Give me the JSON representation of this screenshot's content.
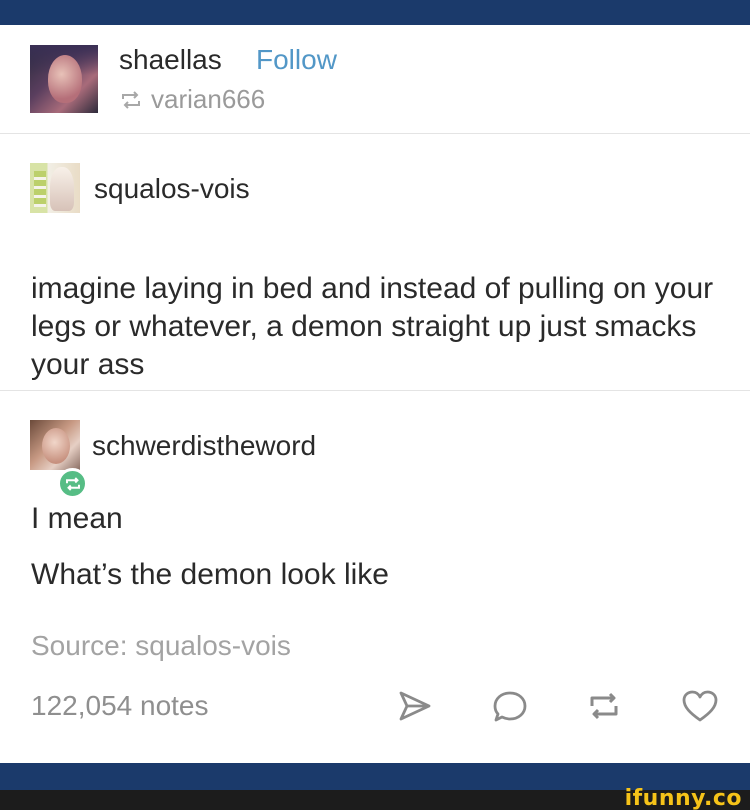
{
  "header": {
    "username": "shaellas",
    "follow_label": "Follow",
    "reblogged_from": "varian666"
  },
  "post_original": {
    "username": "squalos-vois",
    "text": "imagine laying in bed and instead of pulling on your legs or whatever, a demon straight up just smacks your ass"
  },
  "post_reblog": {
    "username": "schwerdistheword",
    "line1": "I mean",
    "line2": "What’s the demon look like"
  },
  "footer_meta": {
    "source": "Source: squalos-vois",
    "notes": "122,054 notes"
  },
  "actions": {
    "icons": [
      "share-icon",
      "reply-icon",
      "reblog-icon",
      "like-icon"
    ]
  },
  "watermark": "ifunny.co",
  "colors": {
    "bar": "#1b3a6b",
    "follow": "#5297c7",
    "reblog_badge": "#56bd85",
    "muted": "#9a9a9a",
    "watermark": "#f6c319"
  }
}
